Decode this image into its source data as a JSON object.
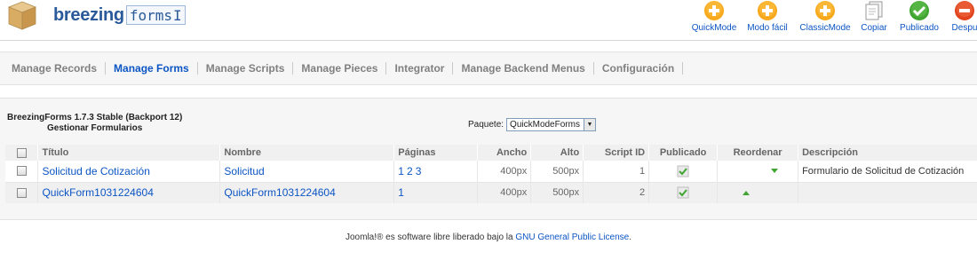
{
  "header": {
    "brand_bold": "breezing",
    "brand_mono": "forms",
    "brand_cursor": "I"
  },
  "toolbar": {
    "buttons": [
      {
        "label": "QuickMode",
        "icon": "plus-icon",
        "color": "#f7a81b"
      },
      {
        "label": "Modo fácil",
        "icon": "plus-icon",
        "color": "#f7a81b"
      },
      {
        "label": "ClassicMode",
        "icon": "plus-icon",
        "color": "#f7a81b"
      },
      {
        "label": "Copiar",
        "icon": "copy-icon",
        "color": "#9a9a9a"
      },
      {
        "label": "Publicado",
        "icon": "check-icon",
        "color": "#3fa530"
      },
      {
        "label": "Despu",
        "icon": "stop-icon",
        "color": "#e2451d"
      }
    ]
  },
  "submenu": {
    "items": [
      {
        "label": "Manage Records",
        "active": false
      },
      {
        "label": "Manage Forms",
        "active": true
      },
      {
        "label": "Manage Scripts",
        "active": false
      },
      {
        "label": "Manage Pieces",
        "active": false
      },
      {
        "label": "Integrator",
        "active": false
      },
      {
        "label": "Manage Backend Menus",
        "active": false
      },
      {
        "label": "Configuración",
        "active": false
      }
    ]
  },
  "content": {
    "title": "BreezingForms 1.7.3 Stable (Backport 12)",
    "subtitle": "Gestionar Formularios",
    "package_label": "Paquete:",
    "package_value": "QuickModeForms"
  },
  "table": {
    "headers": {
      "titulo": "Título",
      "nombre": "Nombre",
      "paginas": "Páginas",
      "ancho": "Ancho",
      "alto": "Alto",
      "script_id": "Script ID",
      "publicado": "Publicado",
      "reordenar": "Reordenar",
      "descripcion": "Descripción"
    },
    "rows": [
      {
        "titulo": "Solicitud de Cotización",
        "nombre": "Solicitud",
        "paginas": [
          "1",
          "2",
          "3"
        ],
        "ancho": "400px",
        "alto": "500px",
        "script_id": "1",
        "descripcion": "Formulario de Solicitud de Cotización"
      },
      {
        "titulo": "QuickForm1031224604",
        "nombre": "QuickForm1031224604",
        "paginas": [
          "1"
        ],
        "ancho": "400px",
        "alto": "500px",
        "script_id": "2",
        "descripcion": ""
      }
    ]
  },
  "footer": {
    "prefix": "Joomla!® es software libre liberado bajo la ",
    "link": "GNU General Public License",
    "suffix": "."
  }
}
